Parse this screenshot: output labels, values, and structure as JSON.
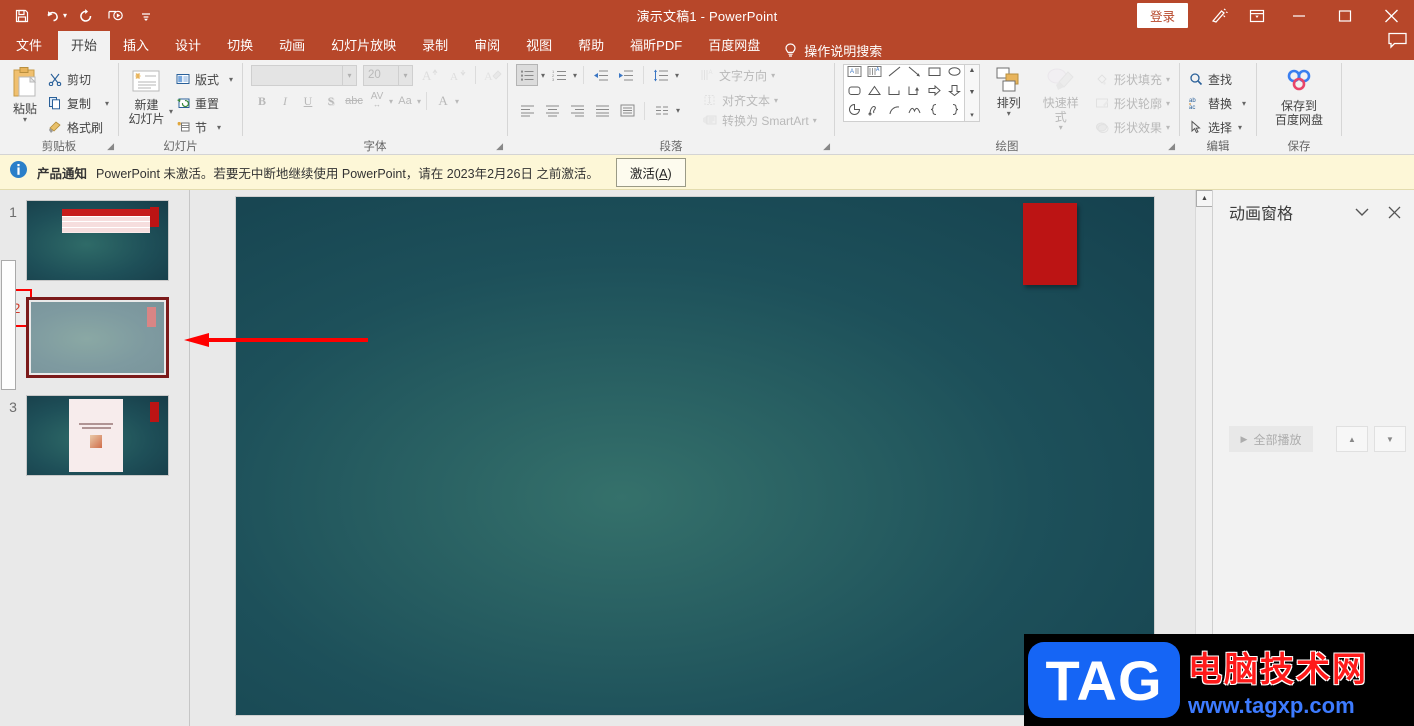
{
  "titlebar": {
    "document_title": "演示文稿1  -  PowerPoint",
    "quick_access": [
      {
        "name": "save-icon",
        "label": "保存"
      },
      {
        "name": "undo-icon",
        "label": "撤消"
      },
      {
        "name": "redo-icon",
        "label": "重复"
      },
      {
        "name": "start-slideshow-icon",
        "label": "从头开始"
      },
      {
        "name": "customize-qat-icon",
        "label": "自定义快速访问工具栏"
      }
    ],
    "signin_label": "登录",
    "ribbon_display_label": "功能区显示选项",
    "minimize_label": "最小化",
    "restore_label": "还原",
    "close_label": "关闭"
  },
  "tabs": [
    {
      "label": "文件",
      "active": false
    },
    {
      "label": "开始",
      "active": true
    },
    {
      "label": "插入",
      "active": false
    },
    {
      "label": "设计",
      "active": false
    },
    {
      "label": "切换",
      "active": false
    },
    {
      "label": "动画",
      "active": false
    },
    {
      "label": "幻灯片放映",
      "active": false
    },
    {
      "label": "录制",
      "active": false
    },
    {
      "label": "审阅",
      "active": false
    },
    {
      "label": "视图",
      "active": false
    },
    {
      "label": "帮助",
      "active": false
    },
    {
      "label": "福昕PDF",
      "active": false
    },
    {
      "label": "百度网盘",
      "active": false
    }
  ],
  "tellme": "操作说明搜索",
  "ribbon": {
    "clipboard": {
      "label": "剪贴板",
      "paste": "粘贴",
      "items": [
        {
          "label": "剪切",
          "icon": "scissors-icon"
        },
        {
          "label": "复制",
          "icon": "copy-icon"
        },
        {
          "label": "格式刷",
          "icon": "format-painter-icon"
        }
      ]
    },
    "slides": {
      "label": "幻灯片",
      "new_slide_line1": "新建",
      "new_slide_line2": "幻灯片",
      "items": [
        {
          "label": "版式",
          "icon": "layout-icon"
        },
        {
          "label": "重置",
          "icon": "reset-icon"
        },
        {
          "label": "节",
          "icon": "section-icon"
        }
      ]
    },
    "font": {
      "label": "字体",
      "font_name_value": "",
      "font_name_placeholder": "",
      "font_size_value": "20",
      "grow_font": "A",
      "shrink_font": "A",
      "clear_format": "清除所有格式",
      "bold": "B",
      "italic": "I",
      "underline": "U",
      "shadow": "S",
      "strikethrough": "abc",
      "char_spacing": "AV",
      "change_case": "Aa",
      "font_color": "A"
    },
    "paragraph": {
      "label": "段落",
      "text_direction": "文字方向",
      "align_text": "对齐文本",
      "convert_smartart": "转换为 SmartArt"
    },
    "drawing": {
      "label": "绘图",
      "arrange": "排列",
      "quick_styles": "快速样式",
      "items": [
        {
          "label": "形状填充",
          "icon": "shape-fill-icon"
        },
        {
          "label": "形状轮廓",
          "icon": "shape-outline-icon"
        },
        {
          "label": "形状效果",
          "icon": "shape-effects-icon"
        }
      ]
    },
    "editing": {
      "label": "编辑",
      "items": [
        {
          "label": "查找",
          "icon": "search-icon"
        },
        {
          "label": "替换",
          "icon": "replace-icon"
        },
        {
          "label": "选择",
          "icon": "select-icon"
        }
      ]
    },
    "save": {
      "label": "保存",
      "baidu_line1": "保存到",
      "baidu_line2": "百度网盘"
    }
  },
  "notice": {
    "badge": "产品通知",
    "message": "PowerPoint 未激活。若要无中断地继续使用 PowerPoint，请在 2023年2月26日 之前激活。",
    "button_prefix": "激活(",
    "button_key": "A",
    "button_suffix": ")"
  },
  "slides": [
    {
      "number": "1",
      "selected": false,
      "content": "table"
    },
    {
      "number": "2",
      "selected": true,
      "content": "blank"
    },
    {
      "number": "3",
      "selected": false,
      "content": "card"
    }
  ],
  "animation_pane": {
    "title": "动画窗格",
    "collapse_label": "折叠",
    "close_label": "关闭",
    "play_all": "全部播放",
    "move_up": "向上移动",
    "move_down": "向下移动"
  },
  "annotations": {
    "arrow_label": "指向幻灯片2的红色箭头",
    "slide_number_box_label": "幻灯片编号2高亮框",
    "arrow_color": "#FF0000",
    "box_color": "#FC0000"
  },
  "watermark": {
    "tag": "TAG",
    "site_name": "电脑技术网",
    "url": "www.tagxp.com"
  },
  "colors": {
    "accent": "#B7472A",
    "slide_red": "#BC1414",
    "notice_bg": "#FDF7D7",
    "ribbon_bg": "#F2F2F2"
  }
}
